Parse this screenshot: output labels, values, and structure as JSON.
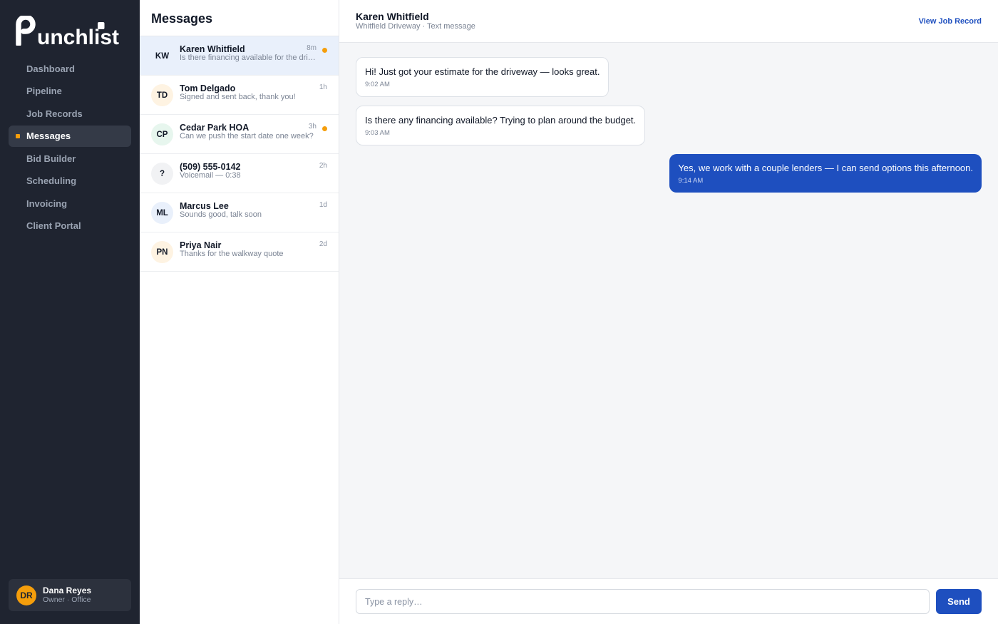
{
  "app": {
    "brand": "Punchlist",
    "colors": {
      "sidebar": "#1f2430",
      "accent": "#f59e0b",
      "primary": "#1e4fbf"
    }
  },
  "sidebar": {
    "items": [
      {
        "label": "Dashboard",
        "active": false
      },
      {
        "label": "Pipeline",
        "active": false
      },
      {
        "label": "Job Records",
        "active": false
      },
      {
        "label": "Messages",
        "active": true
      },
      {
        "label": "Bid Builder",
        "active": false
      },
      {
        "label": "Scheduling",
        "active": false
      },
      {
        "label": "Invoicing",
        "active": false
      },
      {
        "label": "Client Portal",
        "active": false
      }
    ],
    "user": {
      "initials": "DR",
      "name": "Dana Reyes",
      "role": "Owner · Office"
    }
  },
  "inbox": {
    "title": "Messages",
    "conversations": [
      {
        "initials": "KW",
        "name": "Karen Whitfield",
        "preview": "Is there financing available for the driveway?",
        "time": "8m",
        "unread": true,
        "active": true,
        "avatar_color": "#e9f0fb"
      },
      {
        "initials": "TD",
        "name": "Tom Delgado",
        "preview": "Signed and sent back, thank you!",
        "time": "1h",
        "unread": false,
        "active": false,
        "avatar_color": "#fef3e2"
      },
      {
        "initials": "CP",
        "name": "Cedar Park HOA",
        "preview": "Can we push the start date one week?",
        "time": "3h",
        "unread": true,
        "active": false,
        "avatar_color": "#e7f6ee"
      },
      {
        "initials": "?",
        "name": "(509) 555-0142",
        "preview": "Voicemail — 0:38",
        "time": "2h",
        "unread": false,
        "active": false,
        "avatar_color": "#f1f2f4"
      },
      {
        "initials": "ML",
        "name": "Marcus Lee",
        "preview": "Sounds good, talk soon",
        "time": "1d",
        "unread": false,
        "active": false,
        "avatar_color": "#e9f0fb"
      },
      {
        "initials": "PN",
        "name": "Priya Nair",
        "preview": "Thanks for the walkway quote",
        "time": "2d",
        "unread": false,
        "active": false,
        "avatar_color": "#fef3e2"
      }
    ]
  },
  "chat": {
    "contact_name": "Karen Whitfield",
    "subtitle": "Whitfield Driveway · Text message",
    "view_record_label": "View Job Record",
    "messages": [
      {
        "direction": "in",
        "text": "Hi! Just got your estimate for the driveway — looks great.",
        "time": "9:02 AM"
      },
      {
        "direction": "in",
        "text": "Is there any financing available? Trying to plan around the budget.",
        "time": "9:03 AM"
      },
      {
        "direction": "out",
        "text": "Yes, we work with a couple lenders — I can send options this afternoon.",
        "time": "9:14 AM"
      }
    ],
    "reply_placeholder": "Type a reply…",
    "reply_value": "",
    "send_label": "Send"
  }
}
